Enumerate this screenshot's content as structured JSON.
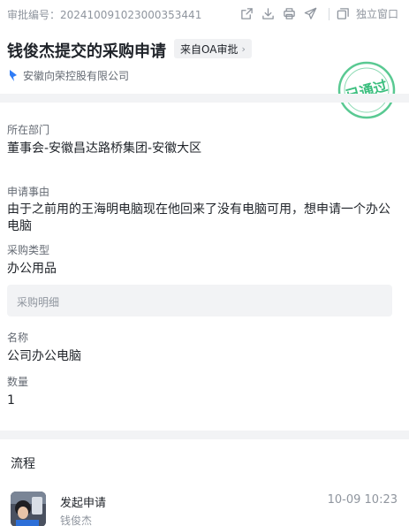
{
  "header": {
    "approval_no": "审批编号：202410091023000353441",
    "standalone_label": "独立窗口"
  },
  "request": {
    "title": "钱俊杰提交的采购申请",
    "source_tag": "来自OA审批",
    "company": "安徽向荣控股有限公司",
    "stamp_text": "已通过",
    "stamp_color": "#3cbf7f"
  },
  "fields": {
    "department_label": "所在部门",
    "department_value": "董事会-安徽昌达路桥集团-安徽大区",
    "reason_label": "申请事由",
    "reason_value": "由于之前用的王海明电脑现在他回来了没有电脑可用，想申请一个办公电脑",
    "type_label": "采购类型",
    "type_value": "办公用品",
    "detail_label": "采购明细",
    "name_label": "名称",
    "name_value": "公司办公电脑",
    "qty_label": "数量",
    "qty_value": "1"
  },
  "flow": {
    "title": "流程",
    "action": "发起申请",
    "person": "钱俊杰",
    "time": "10-09 10:23"
  },
  "icons": [
    "external-link-icon",
    "download-icon",
    "print-icon",
    "send-icon",
    "standalone-window-icon",
    "company-flag-icon",
    "chevron-right-icon"
  ]
}
